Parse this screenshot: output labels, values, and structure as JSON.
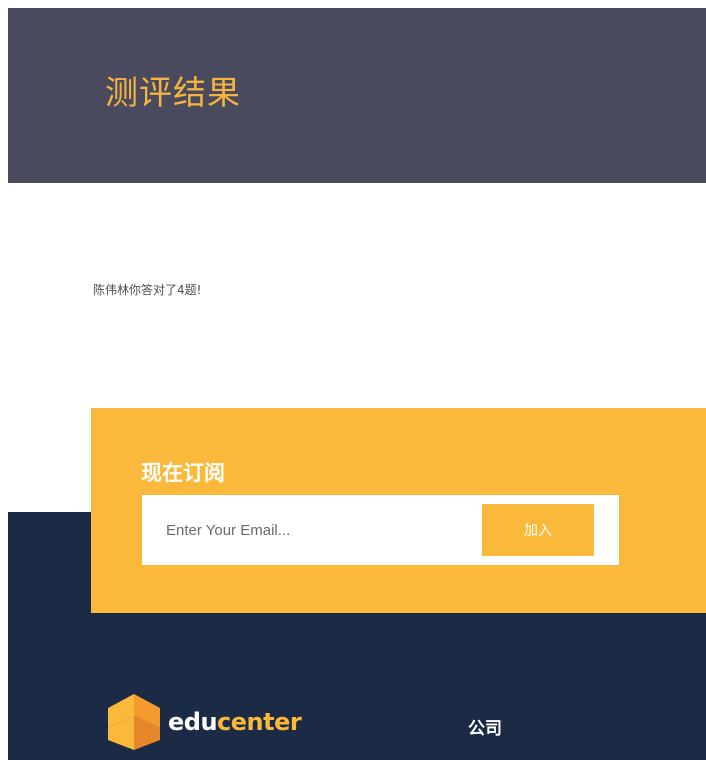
{
  "hero": {
    "title": "测评结果"
  },
  "result": {
    "message": "陈伟林你答对了4题!"
  },
  "subscribe": {
    "title": "现在订阅",
    "email_placeholder": "Enter Your Email...",
    "join_label": "加入"
  },
  "footer": {
    "logo_text_primary": "edu",
    "logo_text_accent": "center",
    "company_heading": "公司"
  },
  "colors": {
    "hero_bg": "#4a4a5e",
    "accent": "#fbb93b",
    "footer_bg": "#1b2b45"
  }
}
